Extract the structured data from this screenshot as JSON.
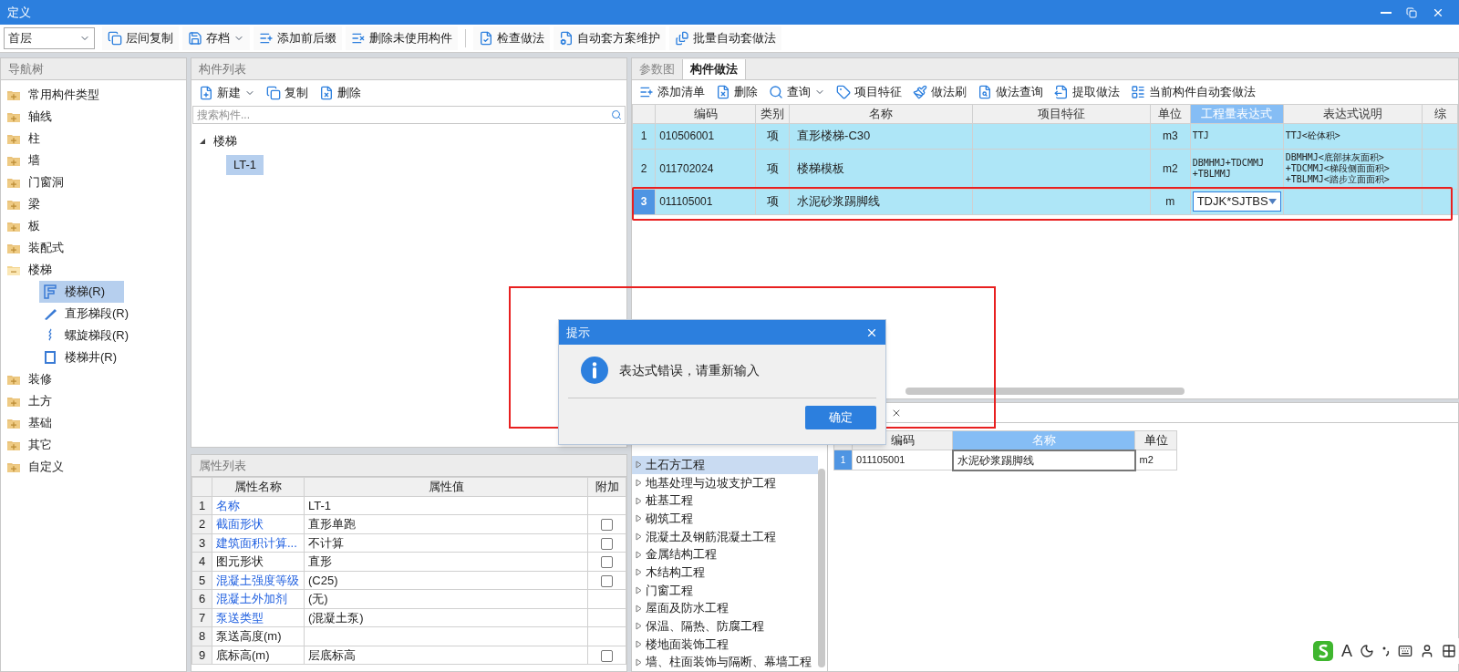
{
  "window": {
    "title": "定义"
  },
  "toolbar": {
    "floor_select": "首层",
    "groups": [
      [
        {
          "label": "层间复制",
          "dropdown": false
        },
        {
          "label": "存档",
          "dropdown": true
        },
        {
          "label": "添加前后缀",
          "dropdown": false
        },
        {
          "label": "删除未使用构件",
          "dropdown": false
        }
      ],
      [
        {
          "label": "检查做法",
          "dropdown": false
        },
        {
          "label": "自动套方案维护",
          "dropdown": false
        },
        {
          "label": "批量自动套做法",
          "dropdown": false
        }
      ]
    ]
  },
  "nav_tree": {
    "title": "导航树",
    "items": [
      {
        "label": "常用构件类型",
        "expanded": false
      },
      {
        "label": "轴线",
        "expanded": false
      },
      {
        "label": "柱",
        "expanded": false
      },
      {
        "label": "墙",
        "expanded": false
      },
      {
        "label": "门窗洞",
        "expanded": false
      },
      {
        "label": "梁",
        "expanded": false
      },
      {
        "label": "板",
        "expanded": false
      },
      {
        "label": "装配式",
        "expanded": false
      },
      {
        "label": "楼梯",
        "expanded": true,
        "children": [
          {
            "label": "楼梯(R)",
            "selected": true
          },
          {
            "label": "直形梯段(R)",
            "selected": false
          },
          {
            "label": "螺旋梯段(R)",
            "selected": false
          },
          {
            "label": "楼梯井(R)",
            "selected": false
          }
        ]
      },
      {
        "label": "装修",
        "expanded": false
      },
      {
        "label": "土方",
        "expanded": false
      },
      {
        "label": "基础",
        "expanded": false
      },
      {
        "label": "其它",
        "expanded": false
      },
      {
        "label": "自定义",
        "expanded": false
      }
    ]
  },
  "component_list": {
    "title": "构件列表",
    "toolbar": [
      {
        "label": "新建",
        "dropdown": true
      },
      {
        "label": "复制",
        "dropdown": false
      },
      {
        "label": "删除",
        "dropdown": false
      }
    ],
    "search": {
      "placeholder": "搜索构件..."
    },
    "tree": [
      {
        "label": "楼梯",
        "expanded": true,
        "children": [
          {
            "label": "LT-1",
            "selected": true
          }
        ]
      }
    ]
  },
  "properties": {
    "title": "属性列表",
    "columns": [
      "属性名称",
      "属性值",
      "附加"
    ],
    "rows": [
      {
        "index": "1",
        "name": "名称",
        "public": true,
        "value": "LT-1",
        "kind": "plain"
      },
      {
        "index": "2",
        "name": "截面形状",
        "public": true,
        "value": "直形单跑",
        "kind": "checkbox",
        "checked": false
      },
      {
        "index": "3",
        "name": "建筑面积计算...",
        "public": true,
        "value": "不计算",
        "kind": "checkbox",
        "checked": false
      },
      {
        "index": "4",
        "name": "图元形状",
        "public": false,
        "value": "直形",
        "kind": "checkbox",
        "checked": false
      },
      {
        "index": "5",
        "name": "混凝土强度等级",
        "public": true,
        "value": "(C25)",
        "kind": "checkbox",
        "checked": false
      },
      {
        "index": "6",
        "name": "混凝土外加剂",
        "public": true,
        "value": "(无)",
        "kind": "plain"
      },
      {
        "index": "7",
        "name": "泵送类型",
        "public": true,
        "value": "(混凝土泵)",
        "kind": "plain"
      },
      {
        "index": "8",
        "name": "泵送高度(m)",
        "public": false,
        "kind": "plain"
      },
      {
        "index": "9",
        "name": "底标高(m)",
        "public": false,
        "value": "层底标高",
        "kind": "checkbox",
        "checked": false
      }
    ]
  },
  "methods": {
    "tabs": [
      {
        "label": "参数图",
        "selected": false
      },
      {
        "label": "构件做法",
        "selected": true
      }
    ],
    "toolbar": [
      {
        "label": "添加清单",
        "dropdown": false
      },
      {
        "label": "删除",
        "dropdown": false
      },
      {
        "label": "查询",
        "dropdown": true
      },
      {
        "label": "项目特征",
        "dropdown": false
      },
      {
        "label": "做法刷",
        "dropdown": false
      },
      {
        "label": "做法查询",
        "dropdown": false
      },
      {
        "label": "提取做法",
        "dropdown": false
      },
      {
        "label": "当前构件自动套做法",
        "dropdown": false
      }
    ],
    "columns": [
      {
        "label": "编码",
        "selected": false
      },
      {
        "label": "类别",
        "selected": false
      },
      {
        "label": "名称",
        "selected": false
      },
      {
        "label": "项目特征",
        "selected": false
      },
      {
        "label": "单位",
        "selected": false
      },
      {
        "label": "工程量表达式",
        "selected": true
      },
      {
        "label": "表达式说明",
        "selected": false
      },
      {
        "label": "综",
        "selected": false
      }
    ],
    "rows": [
      {
        "index": "1",
        "code": "010506001",
        "type": "项",
        "name": "直形楼梯-C30",
        "unit": "m3",
        "expression": [
          "TTJ"
        ],
        "explanation": [
          "TTJ<砼体积>"
        ],
        "selected": false,
        "editing": false
      },
      {
        "index": "2",
        "code": "011702024",
        "type": "项",
        "name": "楼梯模板",
        "unit": "m2",
        "expression": [
          "DBMHMJ+TDCMMJ",
          "+TBLMMJ"
        ],
        "explanation": [
          "DBMHMJ<底部抹灰面积>",
          "+TDCMMJ<梯段侧面面积>",
          "+TBLMMJ<踏步立面面积>"
        ],
        "selected": false,
        "editing": false
      },
      {
        "index": "3",
        "code": "011105001",
        "type": "项",
        "name": "水泥砂浆踢脚线",
        "unit": "m",
        "expression": [
          "TDJK*SJTBS"
        ],
        "selected": true,
        "editing": true
      }
    ]
  },
  "lower": {
    "tree": [
      {
        "label": "土石方工程",
        "selected": true
      },
      {
        "label": "地基处理与边坡支护工程",
        "selected": false
      },
      {
        "label": "桩基工程",
        "selected": false
      },
      {
        "label": "砌筑工程",
        "selected": false
      },
      {
        "label": "混凝土及钢筋混凝土工程",
        "selected": false
      },
      {
        "label": "金属结构工程",
        "selected": false
      },
      {
        "label": "木结构工程",
        "selected": false
      },
      {
        "label": "门窗工程",
        "selected": false
      },
      {
        "label": "屋面及防水工程",
        "selected": false
      },
      {
        "label": "保温、隔热、防腐工程",
        "selected": false
      },
      {
        "label": "楼地面装饰工程",
        "selected": false
      },
      {
        "label": "墙、柱面装饰与隔断、幕墙工程",
        "selected": false
      }
    ],
    "columns": [
      {
        "label": "编码",
        "selected": false
      },
      {
        "label": "名称",
        "selected": true
      },
      {
        "label": "单位",
        "selected": false
      }
    ],
    "rows": [
      {
        "index": "1",
        "code": "011105001",
        "name": "水泥砂浆踢脚线",
        "unit": "m2"
      }
    ]
  },
  "dialog": {
    "title": "提示",
    "message": "表达式错误，请重新输入",
    "button": "确定"
  },
  "ime": {
    "mode": "A"
  }
}
